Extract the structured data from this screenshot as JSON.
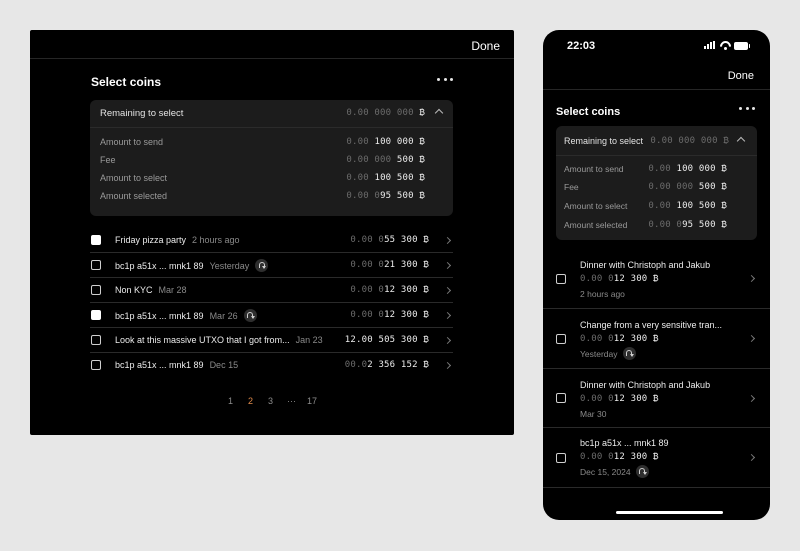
{
  "desktop": {
    "done_label": "Done",
    "title": "Select coins",
    "summary": {
      "remaining_label": "Remaining to select",
      "remaining_dim": "0.00 000 000",
      "remaining_bright": "",
      "rows": [
        {
          "label": "Amount to send",
          "dim": "0.00",
          "bright": " 100 000 ₿"
        },
        {
          "label": "Fee",
          "dim": "0.00 000",
          "bright": " 500 ₿"
        },
        {
          "label": "Amount to select",
          "dim": "0.00",
          "bright": " 100 500 ₿"
        },
        {
          "label": "Amount selected",
          "dim": "0.00 0",
          "bright": "95 500 ₿"
        }
      ],
      "btc_symbol": " ₿"
    },
    "coins": [
      {
        "name": "Friday pizza party",
        "sub": "2 hours ago",
        "dim": "0.00 0",
        "bright": "55 300 ₿",
        "checked": true,
        "badge": false
      },
      {
        "name": "bc1p a51x ... mnk1 89",
        "sub": "Yesterday",
        "dim": "0.00 0",
        "bright": "21 300 ₿",
        "checked": false,
        "badge": true
      },
      {
        "name": "Non KYC",
        "sub": "Mar 28",
        "dim": "0.00 0",
        "bright": "12 300 ₿",
        "checked": false,
        "badge": false
      },
      {
        "name": "bc1p a51x ... mnk1 89",
        "sub": "Mar 26",
        "dim": "0.00 0",
        "bright": "12 300 ₿",
        "checked": true,
        "badge": true
      },
      {
        "name": "Look at this massive UTXO that I got from...",
        "sub": "Jan 23",
        "dim": "",
        "bright": "12.00 505 300 ₿",
        "checked": false,
        "badge": false
      },
      {
        "name": "bc1p a51x ... mnk1 89",
        "sub": "Dec 15",
        "dim": "00.0",
        "bright": "2 356 152 ₿",
        "checked": false,
        "badge": false
      }
    ],
    "pagination": {
      "pages": [
        "1",
        "2",
        "3",
        "···",
        "17"
      ],
      "current": "2"
    }
  },
  "mobile": {
    "time": "22:03",
    "done_label": "Done",
    "title": "Select coins",
    "summary": {
      "remaining_label": "Remaining to select",
      "remaining_dim": "0.00 000 000 ₿",
      "rows": [
        {
          "label": "Amount to send",
          "dim": "0.00",
          "bright": " 100 000 ₿"
        },
        {
          "label": "Fee",
          "dim": "0.00 000",
          "bright": " 500 ₿"
        },
        {
          "label": "Amount to select",
          "dim": "0.00",
          "bright": " 100 500 ₿"
        },
        {
          "label": "Amount selected",
          "dim": "0.00 0",
          "bright": "95 500 ₿"
        }
      ]
    },
    "coins": [
      {
        "name": "Dinner with Christoph and Jakub",
        "dim": "0.00 0",
        "bright": "12 300 ₿",
        "sub": "2 hours ago",
        "badge": false
      },
      {
        "name": "Change from a very sensitive tran...",
        "dim": "0.00 0",
        "bright": "12 300 ₿",
        "sub": "Yesterday",
        "badge": true
      },
      {
        "name": "Dinner with Christoph and Jakub",
        "dim": "0.00 0",
        "bright": "12 300 ₿",
        "sub": "Mar 30",
        "badge": false
      },
      {
        "name": "bc1p a51x ... mnk1 89",
        "dim": "0.00 0",
        "bright": "12 300 ₿",
        "sub": "Dec 15, 2024",
        "badge": true
      }
    ]
  },
  "colors": {
    "accent_page": "#e08a4a",
    "panel_bg": "#000000",
    "card_bg": "#1c1c1c",
    "page_bg": "#e7e7e7"
  }
}
